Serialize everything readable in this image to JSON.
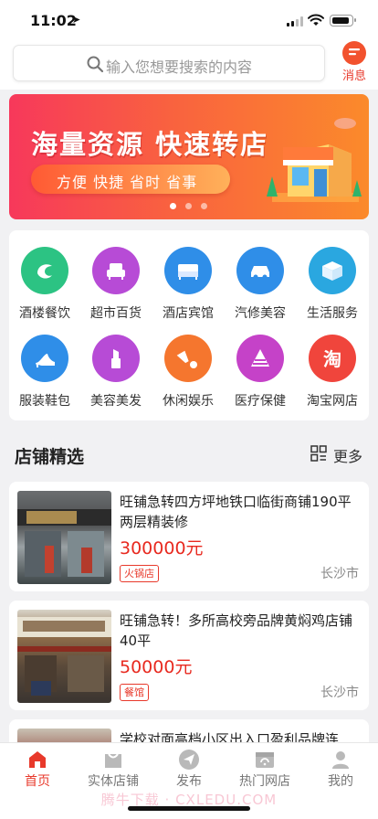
{
  "status_bar": {
    "time": "11:02"
  },
  "header": {
    "search_placeholder": "输入您想要搜索的内容",
    "message_label": "消息"
  },
  "banner": {
    "title": "海量资源 快速转店",
    "subtitle": "方便 快捷 省时 省事",
    "slide_count": 3,
    "active_slide": 1
  },
  "categories": [
    {
      "label": "酒楼餐饮",
      "icon": "shrimp-icon",
      "color": "#2cc383"
    },
    {
      "label": "超市百货",
      "icon": "sofa-icon",
      "color": "#b74bd6"
    },
    {
      "label": "酒店宾馆",
      "icon": "bed-icon",
      "color": "#2f8ee8"
    },
    {
      "label": "汽修美容",
      "icon": "car-icon",
      "color": "#2f8ee8"
    },
    {
      "label": "生活服务",
      "icon": "box-icon",
      "color": "#2aa7e0"
    },
    {
      "label": "服装鞋包",
      "icon": "high-heel-icon",
      "color": "#2f8ee8"
    },
    {
      "label": "美容美发",
      "icon": "lipstick-icon",
      "color": "#b74bd6"
    },
    {
      "label": "休闲娱乐",
      "icon": "shuttlecock-icon",
      "color": "#f5762e"
    },
    {
      "label": "医疗保健",
      "icon": "pills-icon",
      "color": "#c542c8"
    },
    {
      "label": "淘宝网店",
      "icon": "taobao-icon",
      "color": "#f0453c"
    }
  ],
  "section": {
    "title": "店铺精选",
    "more_label": "更多"
  },
  "listings": [
    {
      "title": "旺铺急转四方坪地铁口临街商铺190平两层精装修",
      "price": "300000元",
      "tag": "火锅店",
      "city": "长沙市"
    },
    {
      "title": "旺铺急转！多所高校旁品牌黄焖鸡店铺40平",
      "price": "50000元",
      "tag": "餐馆",
      "city": "长沙市"
    },
    {
      "title": "学校对面高档小区出入口盈利品牌连"
    }
  ],
  "tabbar": {
    "items": [
      {
        "label": "首页",
        "icon": "home-icon",
        "active": true
      },
      {
        "label": "实体店铺",
        "icon": "shop-icon",
        "active": false
      },
      {
        "label": "发布",
        "icon": "send-icon",
        "active": false
      },
      {
        "label": "热门网店",
        "icon": "online-store-icon",
        "active": false
      },
      {
        "label": "我的",
        "icon": "user-icon",
        "active": false
      }
    ]
  },
  "watermark": "腾牛下载 · CXLEDU.COM",
  "colors": {
    "accent": "#e8392b",
    "price": "#e8291f",
    "banner_start": "#f7385b",
    "banner_end": "#fb8a2b"
  }
}
